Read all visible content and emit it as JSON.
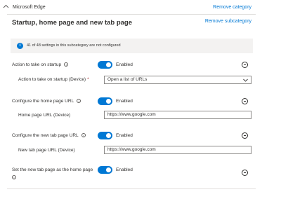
{
  "category": {
    "title": "Microsoft Edge",
    "remove_label": "Remove category"
  },
  "subcategory": {
    "title": "Startup, home page and new tab page",
    "remove_label": "Remove subcategory"
  },
  "info": {
    "text": "41 of 48 settings in this subcategory are not configured",
    "icon": "info-icon"
  },
  "settings": {
    "startup_action": {
      "label": "Action to take on startup",
      "toggle_label": "Enabled",
      "enabled": true,
      "child_label": "Action to take on startup (Device)",
      "required_mark": "*",
      "child_value": "Open a list of URLs"
    },
    "home_page": {
      "label": "Configure the home page URL",
      "toggle_label": "Enabled",
      "enabled": true,
      "child_label": "Home page URL (Device)",
      "child_value": "https://www.google.com"
    },
    "new_tab": {
      "label": "Configure the new tab page URL",
      "toggle_label": "Enabled",
      "enabled": true,
      "child_label": "New tab page URL (Device)",
      "child_value": "https://www.google.com"
    },
    "new_tab_home": {
      "label": "Set the new tab page as the home page",
      "toggle_label": "Enabled",
      "enabled": true
    }
  },
  "help_glyph": "i",
  "colors": {
    "accent": "#0078d4",
    "info_bar": "#f3f2f1",
    "required": "#a4262c",
    "text": "#323130"
  }
}
